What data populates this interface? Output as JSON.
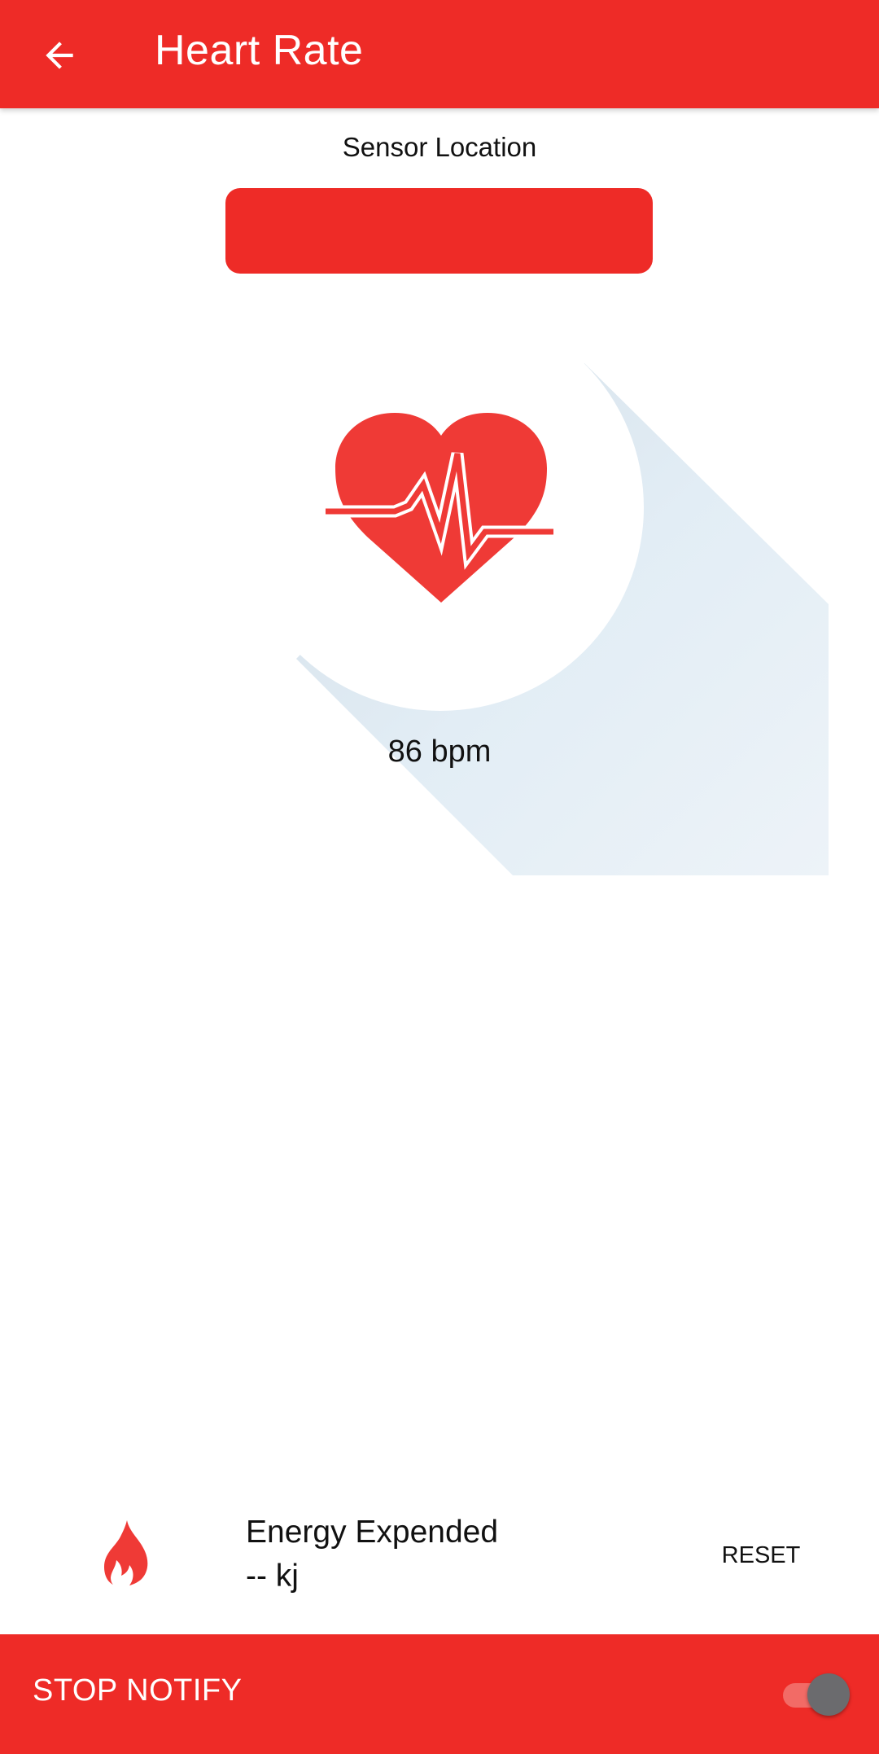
{
  "appbar": {
    "title": "Heart Rate",
    "back_icon": "arrow-left-icon",
    "background": "#ee2b27"
  },
  "sensor": {
    "label": "Sensor Location",
    "value": ""
  },
  "heart_rate": {
    "icon": "heart-pulse-icon",
    "bpm_text": "86 bpm"
  },
  "energy": {
    "icon": "flame-icon",
    "title": "Energy Expended",
    "value": "-- kj",
    "reset_label": "RESET"
  },
  "bottom_bar": {
    "label": "STOP NOTIFY",
    "toggle_on": true
  },
  "colors": {
    "accent": "#ee2b27",
    "heart": "#ef3a36",
    "shadow": "#dfe8f0"
  }
}
